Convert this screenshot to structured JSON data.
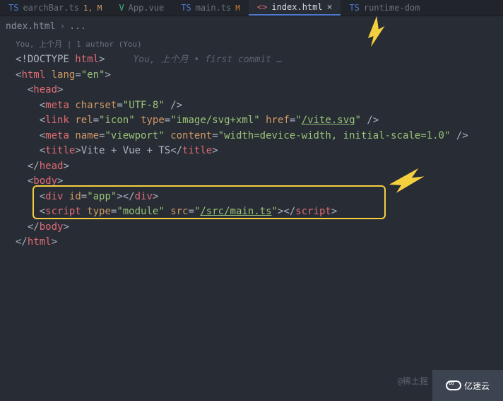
{
  "tabs": [
    {
      "icon": "TS",
      "name": "earchBar.ts",
      "mods": "1, M"
    },
    {
      "icon": "V",
      "name": "App.vue",
      "mods": ""
    },
    {
      "icon": "TS",
      "name": "main.ts",
      "mods": "M"
    },
    {
      "icon": "<>",
      "name": "index.html",
      "mods": "",
      "active": true,
      "close": "×"
    },
    {
      "icon": "TS",
      "name": "runtime-dom",
      "mods": ""
    }
  ],
  "breadcrumb": {
    "file": "ndex.html",
    "sep": "›",
    "rest": "..."
  },
  "author_line": "You, 上个月 | 1 author (You)",
  "code_lens": "You, 上个月 • first commit …",
  "code": {
    "l1_doctype": "<!DOCTYPE ",
    "l1_html": "html",
    "l1_close": ">",
    "l2": {
      "open": "<",
      "tag": "html",
      "sp": " ",
      "attr": "lang",
      "eq": "=",
      "val": "\"en\"",
      "close": ">"
    },
    "l3": {
      "open": "<",
      "tag": "head",
      "close": ">"
    },
    "l4": {
      "open": "<",
      "tag": "meta",
      "sp": " ",
      "a1": "charset",
      "eq": "=",
      "v1": "\"UTF-8\"",
      "close": " />"
    },
    "l5": {
      "open": "<",
      "tag": "link",
      "a1": "rel",
      "v1": "\"icon\"",
      "a2": "type",
      "v2": "\"image/svg+xml\"",
      "a3": "href",
      "v3a": "\"",
      "v3b": "/vite.svg",
      "v3c": "\"",
      "close": " />"
    },
    "l6": {
      "open": "<",
      "tag": "meta",
      "a1": "name",
      "v1": "\"viewport\"",
      "a2": "content",
      "v2": "\"width=device-width, initial-scale=1.0\"",
      "close": " />"
    },
    "l7": {
      "open": "<",
      "tag": "title",
      "close1": ">",
      "text": "Vite + Vue + TS",
      "open2": "</",
      "close2": ">"
    },
    "l8": {
      "open": "</",
      "tag": "head",
      "close": ">"
    },
    "l9": {
      "open": "<",
      "tag": "body",
      "close": ">"
    },
    "l10": {
      "open": "<",
      "tag": "div",
      "a1": "id",
      "v1": "\"app\"",
      "close1": "></",
      "close2": ">"
    },
    "l11": {
      "open": "<",
      "tag": "script",
      "a1": "type",
      "v1": "\"module\"",
      "a2": "src",
      "v2a": "\"",
      "v2b": "/src/main.ts",
      "v2c": "\"",
      "close1": "></",
      "close2": ">"
    },
    "l12": {
      "open": "</",
      "tag": "body",
      "close": ">"
    },
    "l13": {
      "open": "</",
      "tag": "html",
      "close": ">"
    }
  },
  "watermark": {
    "text": "@稀土掘",
    "logo": "亿速云"
  }
}
